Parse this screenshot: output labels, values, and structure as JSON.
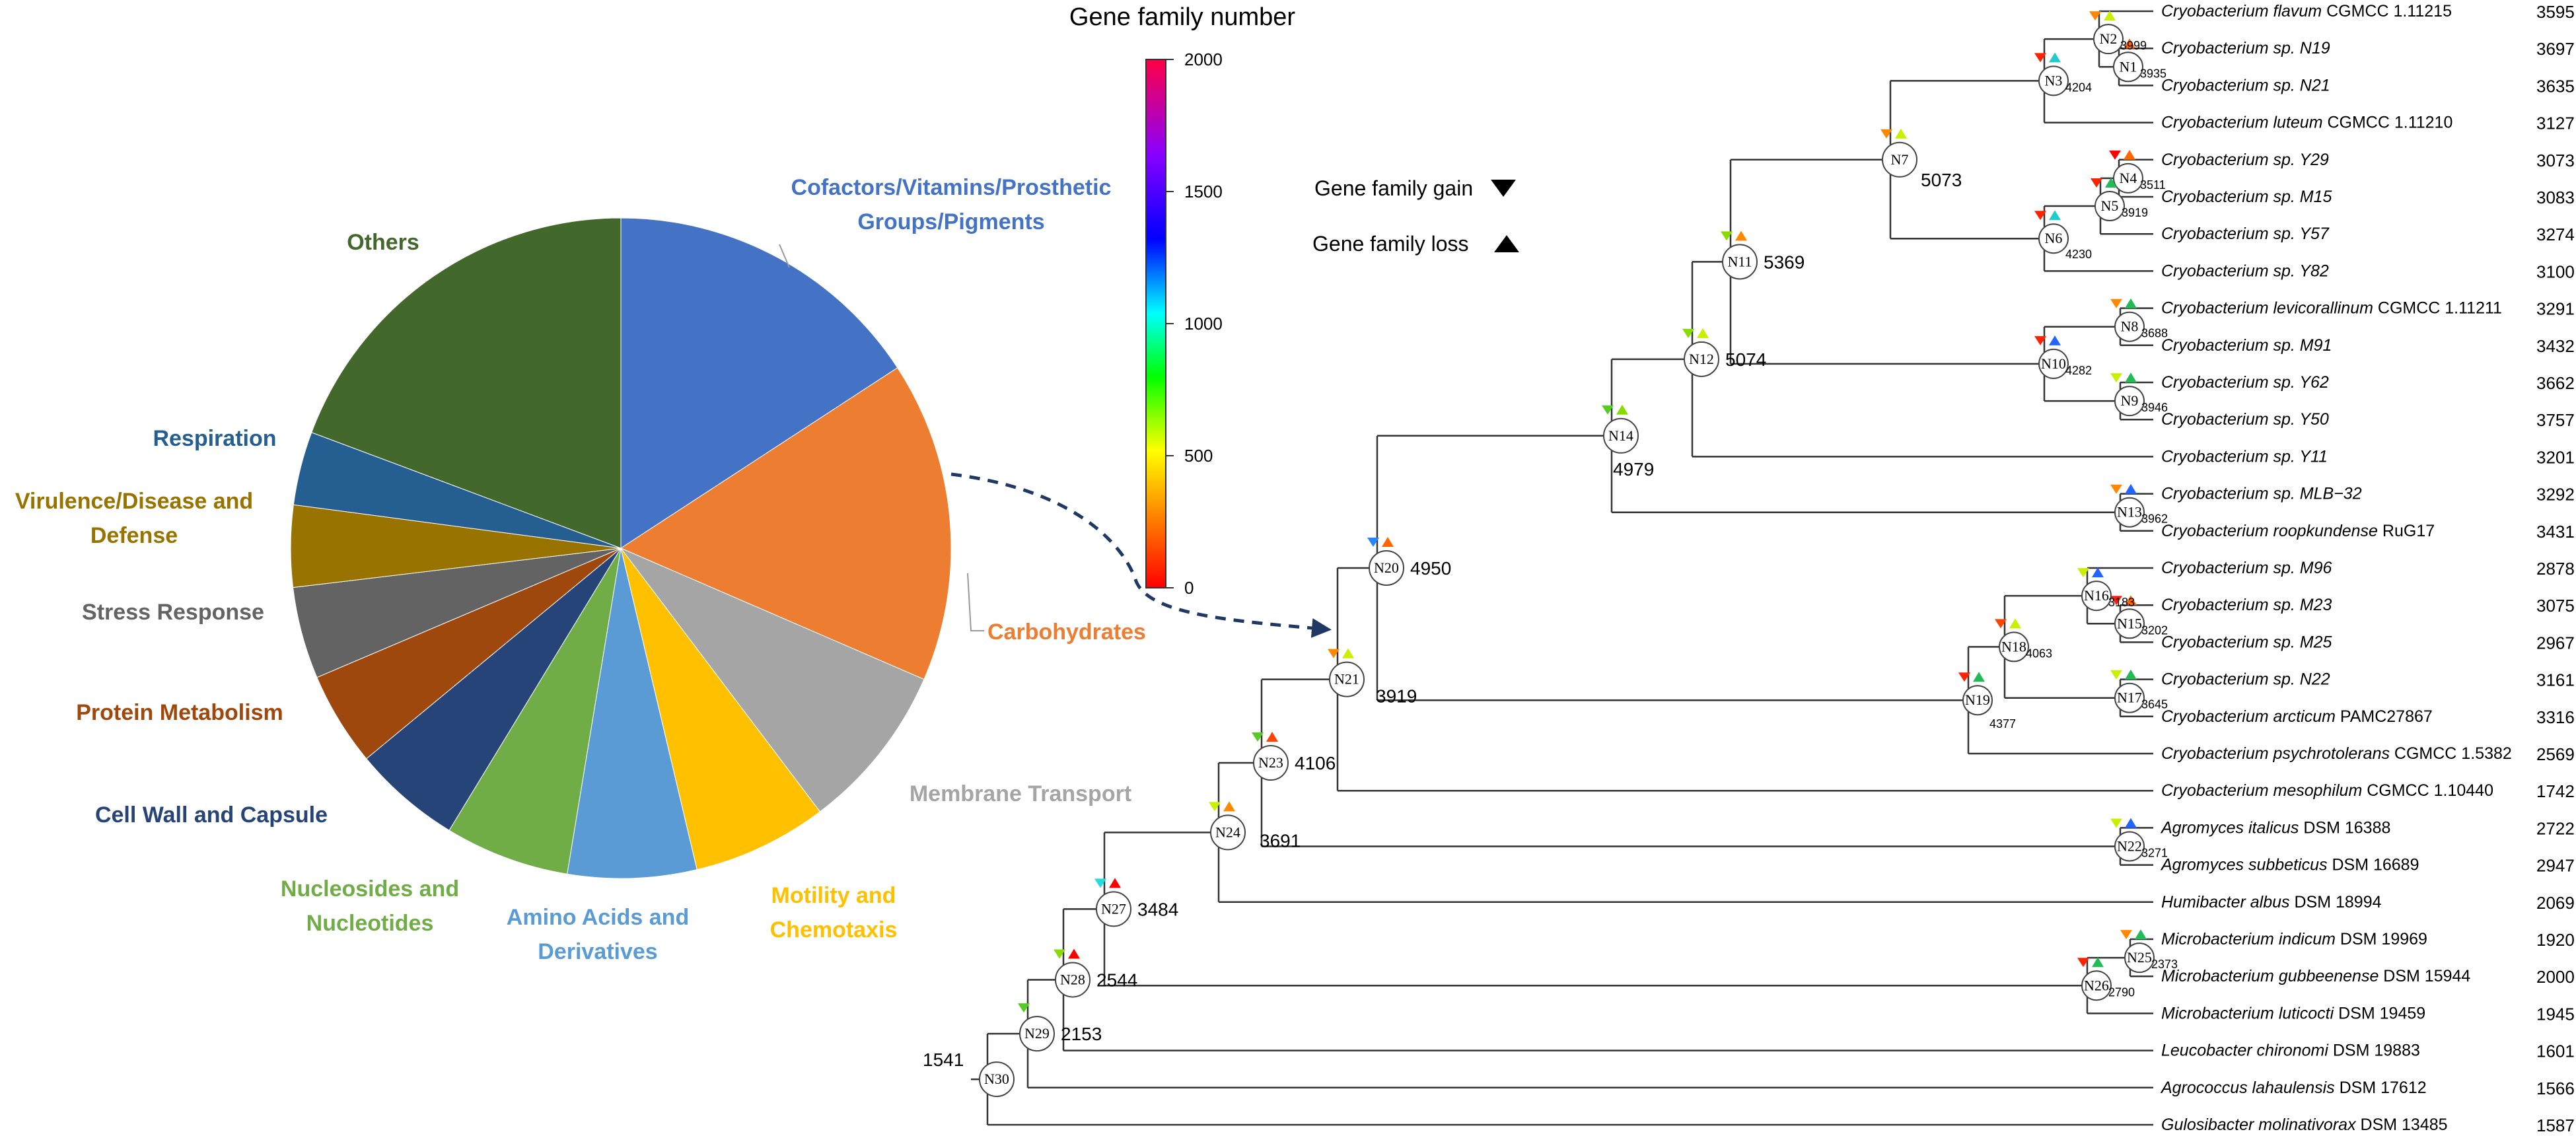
{
  "pie": {
    "slices": [
      {
        "label": "Cofactors/Vitamins/Prosthetic Groups/Pigments",
        "lines": [
          "Cofactors/Vitamins/Prosthetic",
          "Groups/Pigments"
        ],
        "value": 15.8,
        "color": "#4472C4"
      },
      {
        "label": "Carbohydrates",
        "lines": [
          "Carbohydrates"
        ],
        "value": 15.7,
        "color": "#ED7D31"
      },
      {
        "label": "Membrane Transport",
        "lines": [
          "Membrane Transport"
        ],
        "value": 8.2,
        "color": "#A5A5A5"
      },
      {
        "label": "Motility and Chemotaxis",
        "lines": [
          "Motility and",
          "Chemotaxis"
        ],
        "value": 6.6,
        "color": "#FFC000"
      },
      {
        "label": "Amino Acids and Derivatives",
        "lines": [
          "Amino Acids and",
          "Derivatives"
        ],
        "value": 6.3,
        "color": "#5B9BD5"
      },
      {
        "label": "Nucleosides and Nucleotides",
        "lines": [
          "Nucleosides and",
          "Nucleotides"
        ],
        "value": 6.1,
        "color": "#70AD47"
      },
      {
        "label": "Cell Wall and Capsule",
        "lines": [
          "Cell Wall and Capsule"
        ],
        "value": 5.3,
        "color": "#264478"
      },
      {
        "label": "Protein Metabolism",
        "lines": [
          "Protein Metabolism"
        ],
        "value": 4.6,
        "color": "#9E480E"
      },
      {
        "label": "Stress Response",
        "lines": [
          "Stress Response"
        ],
        "value": 4.5,
        "color": "#636363"
      },
      {
        "label": "Virulence/Disease and Defense",
        "lines": [
          "Virulence/Disease and",
          "Defense"
        ],
        "value": 4.0,
        "color": "#997300"
      },
      {
        "label": "Respiration",
        "lines": [
          "Respiration"
        ],
        "value": 3.6,
        "color": "#255E91"
      },
      {
        "label": "Others",
        "lines": [
          "Others"
        ],
        "value": 19.3,
        "color": "#43682B"
      }
    ]
  },
  "colorbar": {
    "title": "Gene family number",
    "ticks": [
      "2000",
      "1500",
      "1000",
      "500",
      "0"
    ]
  },
  "legend": {
    "gain": "Gene family gain",
    "loss": "Gene family loss"
  },
  "tree": {
    "tips": [
      {
        "genus": "Cryobacterium",
        "rest": " flavum",
        "strain": " CGMCC  1.11215",
        "count": "3595"
      },
      {
        "genus": "Cryobacterium",
        "rest": " sp. N19",
        "strain": "",
        "count": "3697"
      },
      {
        "genus": "Cryobacterium",
        "rest": " sp. N21",
        "strain": "",
        "count": "3635"
      },
      {
        "genus": "Cryobacterium",
        "rest": " luteum",
        "strain": " CGMCC 1.11210",
        "count": "3127"
      },
      {
        "genus": "Cryobacterium",
        "rest": " sp. Y29",
        "strain": "",
        "count": "3073"
      },
      {
        "genus": "Cryobacterium",
        "rest": " sp. M15",
        "strain": "",
        "count": "3083"
      },
      {
        "genus": "Cryobacterium",
        "rest": " sp. Y57",
        "strain": "",
        "count": "3274"
      },
      {
        "genus": "Cryobacterium",
        "rest": " sp. Y82",
        "strain": "",
        "count": "3100"
      },
      {
        "genus": "Cryobacterium",
        "rest": " levicorallinum",
        "strain": " CGMCC 1.11211",
        "count": "3291"
      },
      {
        "genus": "Cryobacterium",
        "rest": " sp. M91",
        "strain": "",
        "count": "3432"
      },
      {
        "genus": "Cryobacterium",
        "rest": " sp. Y62",
        "strain": "",
        "count": "3662"
      },
      {
        "genus": "Cryobacterium",
        "rest": " sp. Y50",
        "strain": "",
        "count": "3757"
      },
      {
        "genus": "Cryobacterium",
        "rest": " sp. Y11",
        "strain": "",
        "count": "3201"
      },
      {
        "genus": "Cryobacterium",
        "rest": " sp. MLB−32",
        "strain": "",
        "count": "3292"
      },
      {
        "genus": "Cryobacterium",
        "rest": " roopkundense",
        "strain": " RuG17",
        "count": "3431"
      },
      {
        "genus": "Cryobacterium",
        "rest": " sp.  M96",
        "strain": "",
        "count": "2878"
      },
      {
        "genus": "Cryobacterium",
        "rest": " sp. M23",
        "strain": "",
        "count": "3075"
      },
      {
        "genus": "Cryobacterium",
        "rest": " sp. M25",
        "strain": "",
        "count": "2967"
      },
      {
        "genus": "Cryobacterium",
        "rest": " sp. N22",
        "strain": "",
        "count": "3161"
      },
      {
        "genus": "Cryobacterium",
        "rest": " arcticum",
        "strain": " PAMC27867",
        "count": "3316"
      },
      {
        "genus": "Cryobacterium",
        "rest": " psychrotolerans",
        "strain": " CGMCC 1.5382",
        "count": "2569"
      },
      {
        "genus": "Cryobacterium",
        "rest": " mesophilum",
        "strain": " CGMCC 1.10440",
        "count": "1742"
      },
      {
        "genus": "Agromyces",
        "rest": " italicus",
        "strain": " DSM 16388",
        "count": "2722"
      },
      {
        "genus": "Agromyces",
        "rest": " subbeticus",
        "strain": " DSM 16689",
        "count": "2947"
      },
      {
        "genus": "Humibacter",
        "rest": " albus",
        "strain": " DSM 18994",
        "count": "2069"
      },
      {
        "genus": "Microbacterium",
        "rest": " indicum",
        "strain": " DSM 19969",
        "count": "1920"
      },
      {
        "genus": "Microbacterium",
        "rest": " gubbeenense",
        "strain": " DSM 15944",
        "count": "2000"
      },
      {
        "genus": "Microbacterium",
        "rest": " luticocti",
        "strain": " DSM 19459",
        "count": "1945"
      },
      {
        "genus": "Leucobacter",
        "rest": " chironomi",
        "strain": " DSM 19883",
        "count": "1601"
      },
      {
        "genus": "Agrococcus",
        "rest": " lahaulensis",
        "strain": " DSM 17612",
        "count": "1566"
      },
      {
        "genus": "Gulosibacter",
        "rest": " molinativorax",
        "strain": " DSM 13485",
        "count": "1587"
      }
    ],
    "nodes": [
      {
        "id": "N1",
        "count": "3935",
        "gain": "#ff0000",
        "loss": "#ff6600"
      },
      {
        "id": "N2",
        "count": "3999",
        "gain": "#ff8800",
        "loss": "#ccee00"
      },
      {
        "id": "N3",
        "count": "4204",
        "gain": "#ff2200",
        "loss": "#22cccc"
      },
      {
        "id": "N4",
        "count": "3511",
        "gain": "#ff0000",
        "loss": "#ff6600"
      },
      {
        "id": "N5",
        "count": "3919",
        "gain": "#ff2200",
        "loss": "#22bb55"
      },
      {
        "id": "N6",
        "count": "4230",
        "gain": "#ff2200",
        "loss": "#22cccc"
      },
      {
        "id": "N7",
        "count": "5073",
        "gain": "#ff8800",
        "loss": "#ccee00"
      },
      {
        "id": "N8",
        "count": "3688",
        "gain": "#ff8800",
        "loss": "#22bb55"
      },
      {
        "id": "N9",
        "count": "3946",
        "gain": "#ccee00",
        "loss": "#22bb55"
      },
      {
        "id": "N10",
        "count": "4282",
        "gain": "#ff2200",
        "loss": "#2266ff"
      },
      {
        "id": "N11",
        "count": "5369",
        "gain": "#88dd00",
        "loss": "#ff8800"
      },
      {
        "id": "N12",
        "count": "5074",
        "gain": "#88dd00",
        "loss": "#ccee00"
      },
      {
        "id": "N13",
        "count": "3962",
        "gain": "#ff8800",
        "loss": "#2266ff"
      },
      {
        "id": "N14",
        "count": "4979",
        "gain": "#55cc22",
        "loss": "#88dd00"
      },
      {
        "id": "N15",
        "count": "3202",
        "gain": "#ff2200",
        "loss": "#ff6600"
      },
      {
        "id": "N16",
        "count": "3183",
        "gain": "#ccee00",
        "loss": "#2266ff"
      },
      {
        "id": "N17",
        "count": "3645",
        "gain": "#ccee00",
        "loss": "#22bb55"
      },
      {
        "id": "N18",
        "count": "4063",
        "gain": "#ff4400",
        "loss": "#ccee00"
      },
      {
        "id": "N19",
        "count": "4377",
        "gain": "#ff2200",
        "loss": "#22bb55"
      },
      {
        "id": "N20",
        "count": "4950",
        "gain": "#2288ff",
        "loss": "#ff6600"
      },
      {
        "id": "N21",
        "count": "3919",
        "gain": "#ff8800",
        "loss": "#ccee00"
      },
      {
        "id": "N22",
        "count": "3271",
        "gain": "#ccee00",
        "loss": "#2266ff"
      },
      {
        "id": "N23",
        "count": "4106",
        "gain": "#55cc22",
        "loss": "#ff4400"
      },
      {
        "id": "N24",
        "count": "3691",
        "gain": "#ccee00",
        "loss": "#ff8800"
      },
      {
        "id": "N25",
        "count": "2373",
        "gain": "#ff8800",
        "loss": "#22bb55"
      },
      {
        "id": "N26",
        "count": "2790",
        "gain": "#ff2200",
        "loss": "#22bb55"
      },
      {
        "id": "N27",
        "count": "3484",
        "gain": "#22dddd",
        "loss": "#ff0000"
      },
      {
        "id": "N28",
        "count": "2544",
        "gain": "#88dd00",
        "loss": "#ff0000"
      },
      {
        "id": "N29",
        "count": "2153",
        "gain": "#55cc22",
        "loss": ""
      },
      {
        "id": "N30",
        "count": "1541",
        "gain": "",
        "loss": ""
      }
    ]
  }
}
